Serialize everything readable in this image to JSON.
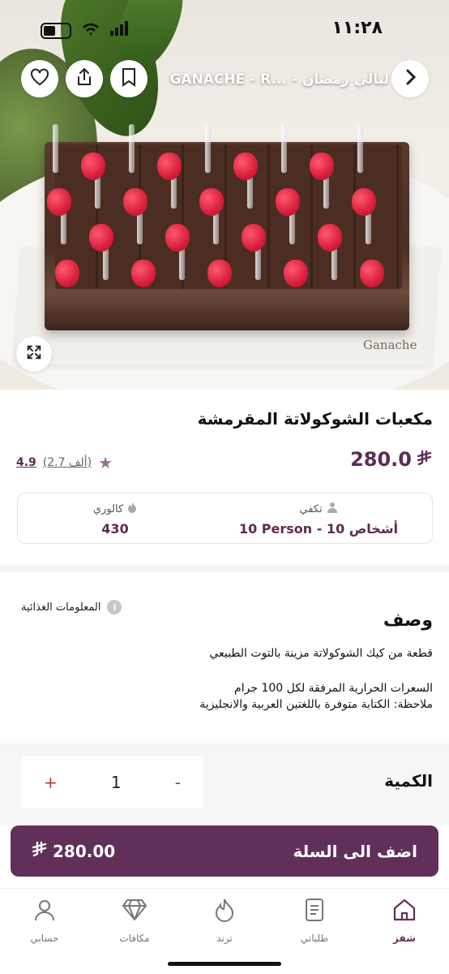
{
  "status_bar": {
    "time": "١١:٢٨"
  },
  "header": {
    "title": "GANACHE - R... - ليالي رمضان",
    "icons": [
      "heart-icon",
      "share-icon",
      "bookmark-icon",
      "chevron-right-icon"
    ]
  },
  "hero": {
    "brand_mark": "Ganache",
    "expand_icon": "expand-icon"
  },
  "product": {
    "title": "مكعبات الشوكولاتة المقرمشة",
    "price": "280.0",
    "currency_icon": "riyal-icon",
    "rating_value": "4.9",
    "rating_count": "(2.7 ألف)",
    "serves_label": "تكفي",
    "serves_value": "10 Person - 10 أشخاص",
    "calories_label": "كالوري",
    "calories_value": "430"
  },
  "description": {
    "heading": "وصف",
    "nutrition_link": "المعلومات الغذائية",
    "line1": "قطعة من كيك الشوكولاتة مزينة بالتوت الطبيعي",
    "line2": "السعرات الحرارية المرفقة لكل 100 جرام",
    "line3": "ملاحظة: الكتابة متوفرة باللغتين العربية والانجليزية"
  },
  "quantity": {
    "label": "الكمية",
    "value": "1",
    "minus": "-",
    "plus": "+"
  },
  "cart": {
    "label": "اضف الى السلة",
    "amount": "280.00"
  },
  "tabbar": {
    "items": [
      {
        "label": "شفز",
        "icon": "home-icon",
        "active": true
      },
      {
        "label": "طلباتي",
        "icon": "orders-icon",
        "active": false
      },
      {
        "label": "ترند",
        "icon": "flame-icon",
        "active": false
      },
      {
        "label": "مكافات",
        "icon": "diamond-icon",
        "active": false
      },
      {
        "label": "حسابي",
        "icon": "user-icon",
        "active": false
      }
    ]
  },
  "colors": {
    "brand": "#61305a",
    "price": "#5f2a55",
    "accent_plus": "#c0392b"
  }
}
